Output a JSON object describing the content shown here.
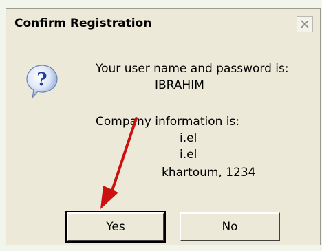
{
  "dialog": {
    "title": "Confirm Registration",
    "close_label": "×",
    "line1": "Your user name and password is:",
    "username": "IBRAHIM",
    "line2": "Company information is:",
    "company_line1": "i.el",
    "company_line2": "i.el",
    "company_line3": "khartoum,  1234",
    "yes_label": "Yes",
    "no_label": "No"
  },
  "icons": {
    "question": "question-icon",
    "close": "close-icon",
    "arrow": "arrow-annotation"
  },
  "colors": {
    "dialog_bg": "#ece9d8",
    "icon_blue": "#2f5fb3",
    "arrow_red": "#cc1111"
  }
}
